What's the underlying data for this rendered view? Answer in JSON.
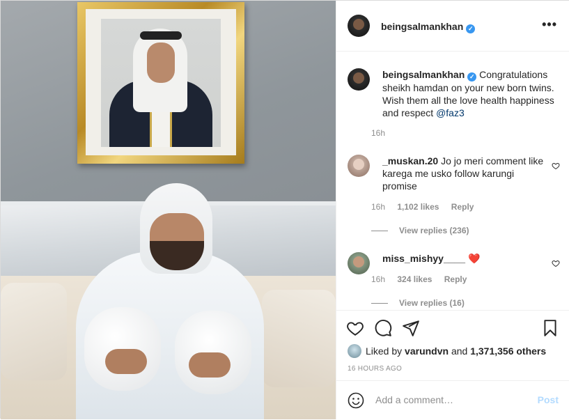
{
  "post": {
    "username": "beingsalmankhan",
    "verified_icon": "verified-badge-icon",
    "more_label": "•••",
    "caption": {
      "username": "beingsalmankhan",
      "text": "Congratulations sheikh hamdan on your new born twins. Wish them all the love health happiness and respect ",
      "mention": "@faz3",
      "time": "16h"
    },
    "comments": [
      {
        "username": "_muskan.20",
        "text": "Jo jo meri comment like karega me usko follow karungi promise",
        "time": "16h",
        "likes": "1,102 likes",
        "reply_label": "Reply",
        "view_replies": "View replies (236)"
      },
      {
        "username": "miss_mishyy____",
        "text": "❤️",
        "time": "16h",
        "likes": "324 likes",
        "reply_label": "Reply",
        "view_replies": "View replies (16)"
      }
    ],
    "liked_by": {
      "prefix": "Liked by",
      "user": "varundvn",
      "middle": "and",
      "others": "1,371,356 others"
    },
    "timestamp": "16 HOURS AGO",
    "add_comment": {
      "placeholder": "Add a comment…",
      "post_label": "Post"
    }
  },
  "colors": {
    "verified": "#3897f0",
    "mention": "#00376b",
    "post_disabled": "#b3dbff",
    "secondary_text": "#8e8e8e"
  }
}
